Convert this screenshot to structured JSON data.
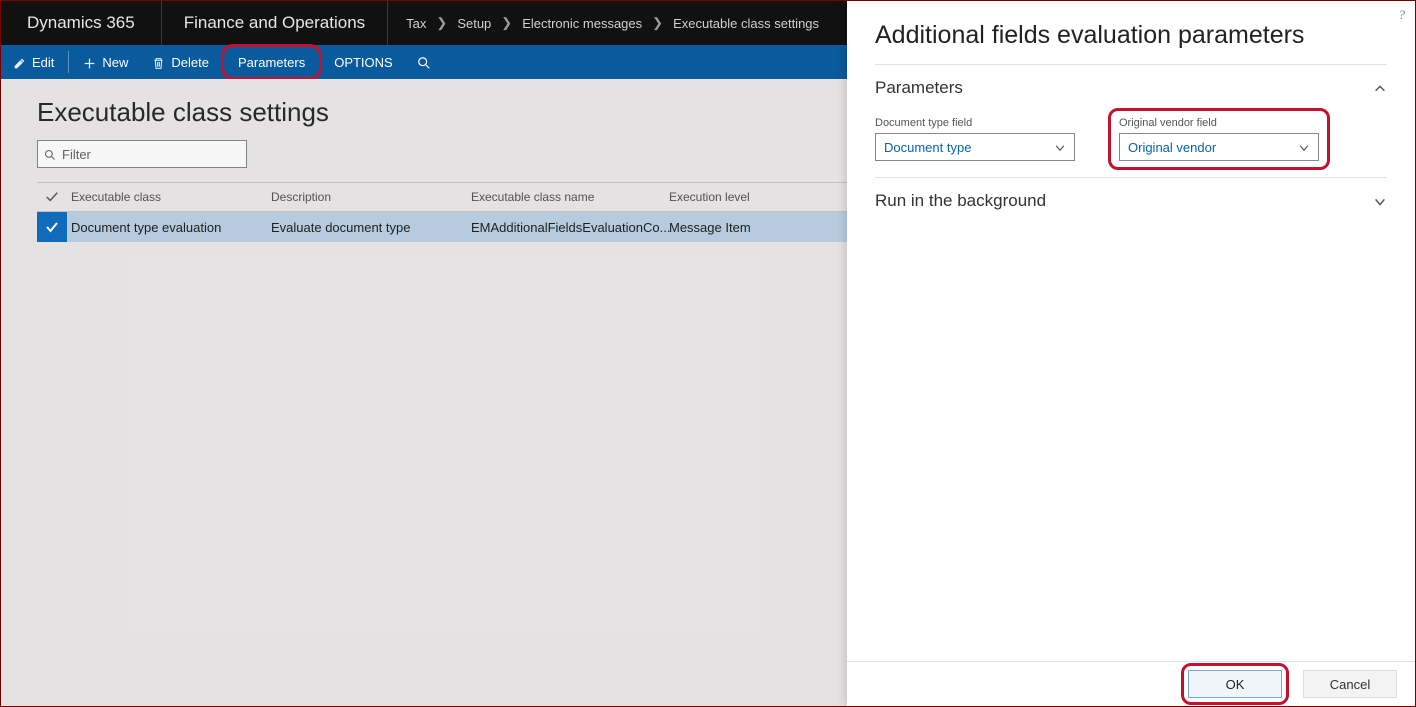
{
  "header": {
    "brand": "Dynamics 365",
    "module": "Finance and Operations",
    "breadcrumbs": [
      "Tax",
      "Setup",
      "Electronic messages",
      "Executable class settings"
    ]
  },
  "actions": {
    "edit": "Edit",
    "new": "New",
    "delete": "Delete",
    "parameters": "Parameters",
    "options": "OPTIONS"
  },
  "page": {
    "title": "Executable class settings",
    "filter_placeholder": "Filter"
  },
  "grid": {
    "columns": {
      "executable_class": "Executable class",
      "description": "Description",
      "executable_class_name": "Executable class name",
      "execution_level": "Execution level"
    },
    "rows": [
      {
        "executable_class": "Document type evaluation",
        "description": "Evaluate document type",
        "executable_class_name": "EMAdditionalFieldsEvaluationCo...",
        "execution_level": "Message Item"
      }
    ]
  },
  "panel": {
    "title": "Additional fields evaluation parameters",
    "sections": {
      "parameters": "Parameters",
      "background": "Run in the background"
    },
    "fields": {
      "doc_type_label": "Document type field",
      "doc_type_value": "Document type",
      "orig_vendor_label": "Original vendor field",
      "orig_vendor_value": "Original vendor"
    },
    "buttons": {
      "ok": "OK",
      "cancel": "Cancel"
    }
  }
}
